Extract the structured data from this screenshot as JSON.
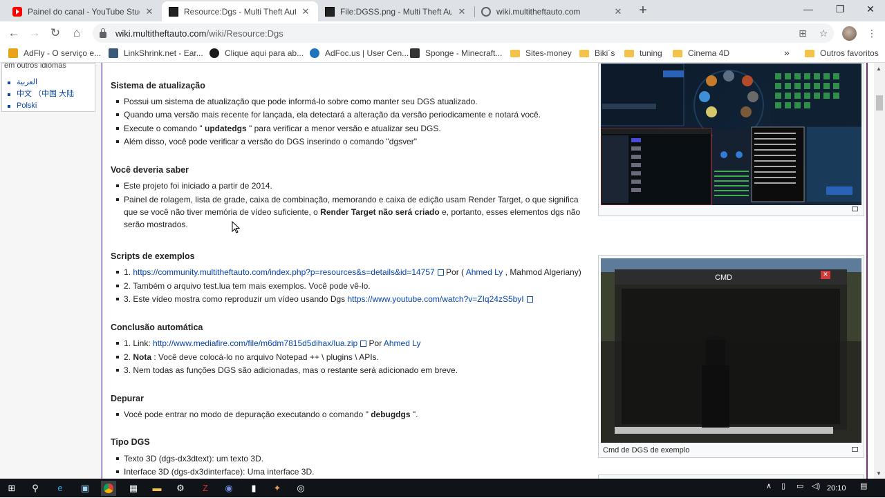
{
  "tabs": [
    {
      "title": "Painel do canal - YouTube Studio",
      "icon": "youtube-icon",
      "active": false
    },
    {
      "title": "Resource:Dgs - Multi Theft Auto",
      "icon": "mta-icon",
      "active": true
    },
    {
      "title": "File:DGSS.png - Multi Theft Auto",
      "icon": "mta-icon",
      "active": false
    },
    {
      "title": "wiki.multitheftauto.com",
      "icon": "globe-icon",
      "active": false
    }
  ],
  "toolbar": {
    "url_host": "wiki.multitheftauto.com",
    "url_path": "/wiki/Resource:Dgs"
  },
  "bookmarks": [
    {
      "label": "AdFly - O serviço e...",
      "icon": "adfly-icon"
    },
    {
      "label": "LinkShrink.net - Ear...",
      "icon": "linkshrink-icon"
    },
    {
      "label": "Clique aqui para ab...",
      "icon": "link-icon"
    },
    {
      "label": "AdFoc.us | User Cen...",
      "icon": "adfocus-icon"
    },
    {
      "label": "Sponge - Minecraft...",
      "icon": "sponge-icon"
    },
    {
      "label": "Sites-money",
      "icon": "folder-icon"
    },
    {
      "label": "Biki´s",
      "icon": "folder-icon"
    },
    {
      "label": "tuning",
      "icon": "folder-icon"
    },
    {
      "label": "Cinema 4D",
      "icon": "folder-icon"
    }
  ],
  "bookmarks_more": "»",
  "bookmarks_other": "Outros favoritos",
  "sidebar": {
    "header": "em outros idiomas",
    "languages": [
      "العربية",
      "中文 （中国 大陆",
      "Polski"
    ]
  },
  "sections": {
    "update": {
      "title": "Sistema de atualização",
      "items": [
        "Possui um sistema de atualização que pode informá-lo sobre como manter seu DGS atualizado.",
        "Quando uma versão mais recente for lançada, ela detectará a alteração da versão periodicamente e notará você.",
        {
          "pre": "Execute o comando \" ",
          "bold": "updatedgs",
          "post": " \" para verificar a menor versão e atualizar seu DGS."
        },
        "Além disso, você pode verificar a versão do DGS inserindo o comando \"dgsver\""
      ]
    },
    "know": {
      "title": "Você deveria saber",
      "items": [
        "Este projeto foi iniciado a partir de 2014.",
        {
          "pre": "Painel de rolagem, lista de grade, caixa de combinação, memorando e caixa de edição usam Render Target, o que significa que se você não tiver memória de vídeo suficiente, o ",
          "bold": "Render Target não será criado",
          "post": " e, portanto, esses elementos dgs não serão mostrados."
        }
      ]
    },
    "examples": {
      "title": "Scripts de exemplos",
      "item1_prefix": "1. ",
      "item1_link": "https://community.multitheftauto.com/index.php?p=resources&s=details&id=14757",
      "item1_by": " Por ( ",
      "item1_author": "Ahmed Ly",
      "item1_rest": " , Mahmod Algeriany)",
      "item2": "2. Também o arquivo test.lua tem mais exemplos. Você pode vê-lo.",
      "item3_prefix": "3. Este vídeo mostra como reproduzir um vídeo usando Dgs ",
      "item3_link": "https://www.youtube.com/watch?v=ZIq24zS5byI"
    },
    "autocomplete": {
      "title": "Conclusão automática",
      "item1_prefix": "1. Link: ",
      "item1_link": "http://www.mediafire.com/file/m6dm7815d5dihax/lua.zip",
      "item1_by": " Por ",
      "item1_author": "Ahmed Ly",
      "item2_prefix": "2. ",
      "item2_bold": "Nota",
      "item2_rest": " : Você deve colocá-lo no arquivo Notepad ++ \\ plugins \\ APIs.",
      "item3": "3. Nem todas as funções DGS são adicionadas, mas o restante será adicionado em breve."
    },
    "debug": {
      "title": "Depurar",
      "pre": "Você pode entrar no modo de depuração executando o comando \" ",
      "bold": "debugdgs",
      "post": " \"."
    },
    "types": {
      "title": "Tipo DGS",
      "items": [
        "Texto 3D (dgs-dx3dtext): um texto 3D.",
        "Interface 3D (dgs-dx3dinterface): Uma interface 3D."
      ]
    }
  },
  "thumb2": {
    "caption": "Cmd de DGS de exemplo",
    "window_title": "CMD"
  },
  "taskbar": {
    "time": "20:10"
  }
}
